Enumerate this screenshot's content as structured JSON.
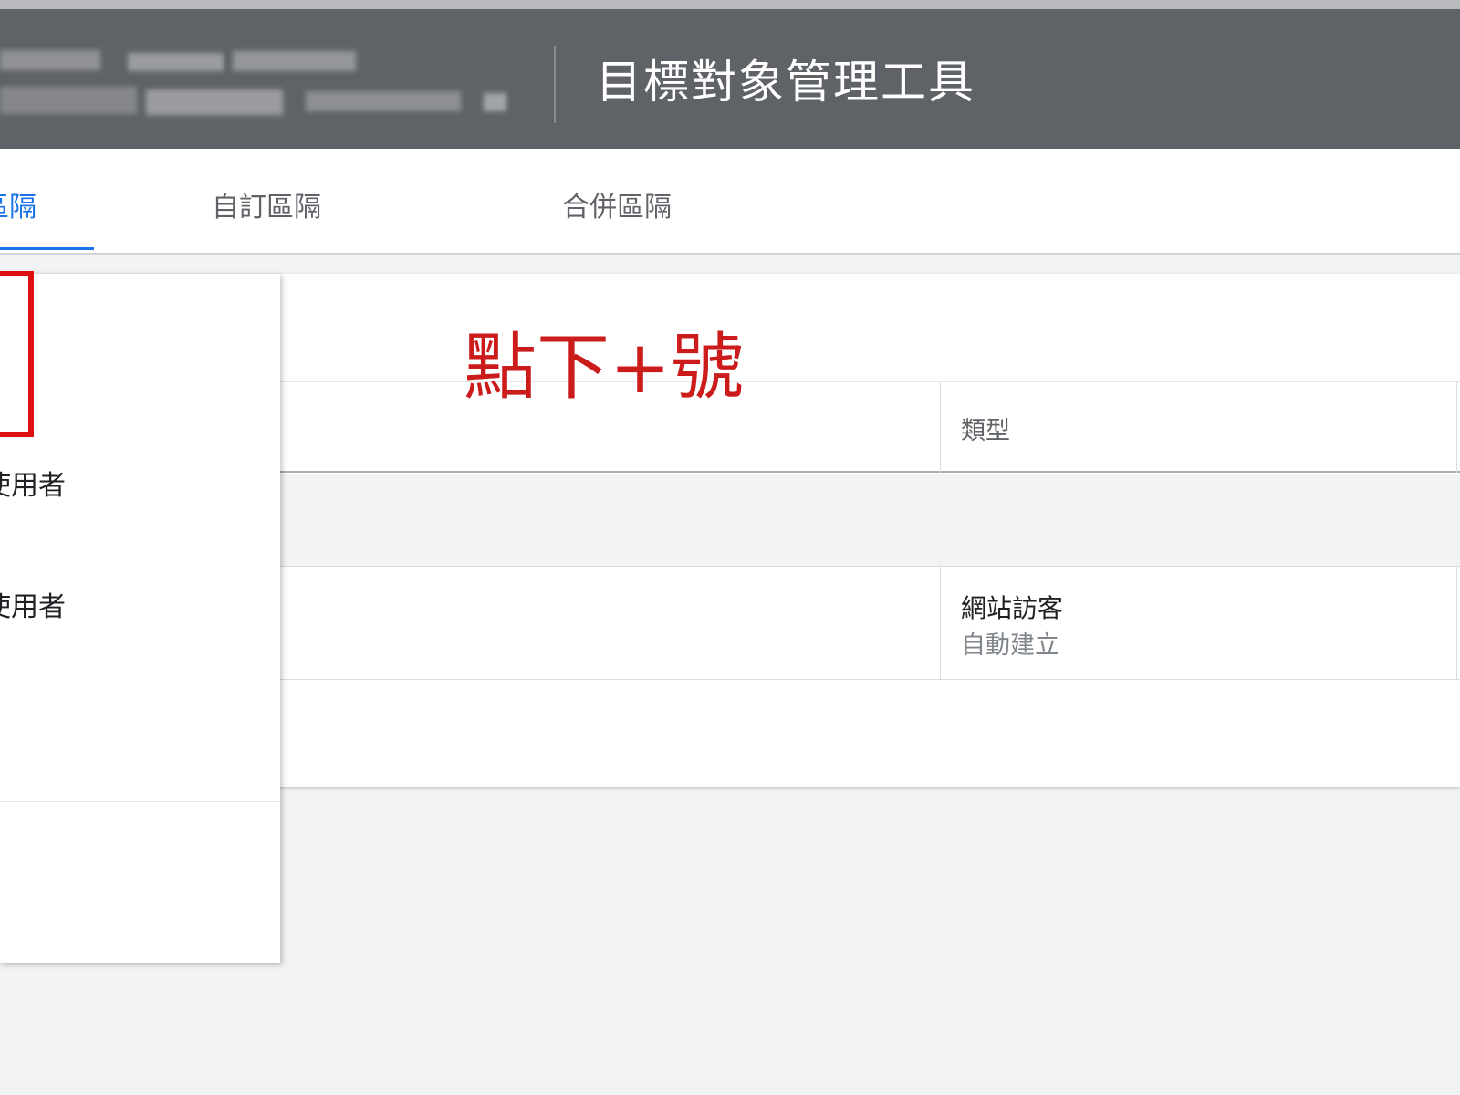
{
  "header": {
    "title": "目標對象管理工具"
  },
  "tabs": [
    {
      "label": "區隔",
      "active": true
    },
    {
      "label": "自訂區隔",
      "active": false
    },
    {
      "label": "合併區隔",
      "active": false
    }
  ],
  "table": {
    "columns": {
      "type": "類型"
    },
    "rows": [
      {
        "type": "網站訪客",
        "sub": "自動建立"
      }
    ]
  },
  "annotation": {
    "text": "點下+號",
    "color": "#cc1b1b"
  },
  "menu": {
    "items": [
      {
        "label": "使用者"
      },
      {
        "label": "使用者"
      }
    ]
  },
  "colors": {
    "header_bg": "#5f6368",
    "accent": "#1a73e8",
    "highlight": "#e01010"
  }
}
